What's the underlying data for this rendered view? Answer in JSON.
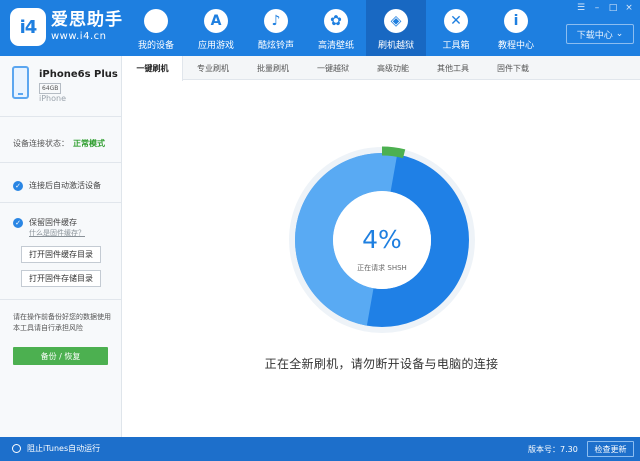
{
  "app": {
    "logo_text": "i4",
    "brand_name": "爱思助手",
    "brand_url": "www.i4.cn"
  },
  "window_controls": [
    "☰",
    "–",
    "□",
    "×"
  ],
  "nav": [
    {
      "label": "我的设备",
      "icon": "apple-icon",
      "glyph": "",
      "active": false
    },
    {
      "label": "应用游戏",
      "icon": "app-store-icon",
      "glyph": "A",
      "active": false
    },
    {
      "label": "酷炫铃声",
      "icon": "bell-icon",
      "glyph": "♪",
      "active": false
    },
    {
      "label": "高清壁纸",
      "icon": "flower-icon",
      "glyph": "✿",
      "active": false
    },
    {
      "label": "刷机越狱",
      "icon": "dropbox-icon",
      "glyph": "◈",
      "active": true
    },
    {
      "label": "工具箱",
      "icon": "tools-icon",
      "glyph": "✕",
      "active": false
    },
    {
      "label": "教程中心",
      "icon": "info-icon",
      "glyph": "i",
      "active": false
    }
  ],
  "download_center": {
    "label": "下载中心",
    "icon": "chevron-down-icon",
    "glyph": "⌄"
  },
  "device": {
    "name": "iPhone6s Plus",
    "storage": "64GB",
    "model": "iPhone"
  },
  "sidebar": {
    "status_label": "设备连接状态：",
    "status_value": "正常模式",
    "auto_activate": "连接后自动激活设备",
    "keep_cache": "保留固件缓存",
    "what_is_cache": "什么是固件缓存？",
    "open_cache_dir": "打开固件缓存目录",
    "open_store_dir": "打开固件存储目录",
    "warning": "请在操作前备份好您的数据使用本工具请自行承担风险",
    "backup_button": "备份 / 恢复"
  },
  "tabs": [
    {
      "label": "一键刷机",
      "active": true
    },
    {
      "label": "专业刷机",
      "active": false
    },
    {
      "label": "批量刷机",
      "active": false
    },
    {
      "label": "一键越狱",
      "active": false
    },
    {
      "label": "高级功能",
      "active": false
    },
    {
      "label": "其他工具",
      "active": false
    },
    {
      "label": "固件下载",
      "active": false
    }
  ],
  "progress": {
    "percent_text": "4%",
    "value": 0.04,
    "status": "正在请求 SHSH",
    "message": "正在全新刷机，请勿断开设备与电脑的连接"
  },
  "colors": {
    "accent": "#1e7fe0",
    "ring_dark": "#1f80e6",
    "ring_light": "#6eb8f7",
    "progress_green": "#4cb050"
  },
  "statusbar": {
    "itunes": "阻止iTunes自动运行",
    "version": "版本号：7.30",
    "update_button": "检查更新"
  }
}
